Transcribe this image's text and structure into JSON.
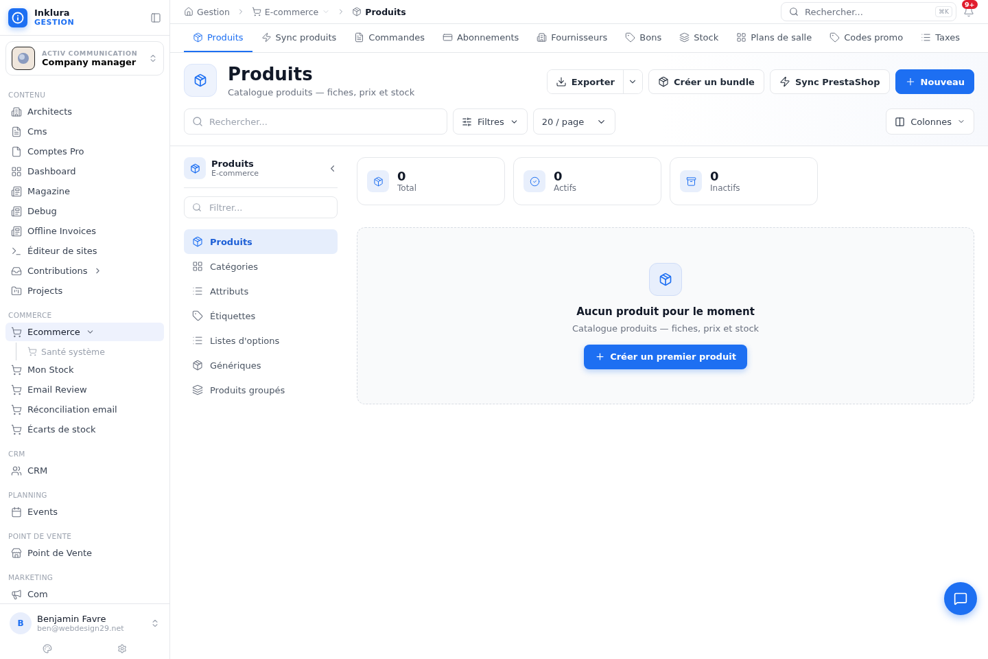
{
  "brand": {
    "name": "Inklura",
    "subtitle": "GESTION"
  },
  "workspace": {
    "org": "ACTIV COMMUNICATION",
    "role": "Company manager"
  },
  "sidebar": {
    "sections": [
      {
        "label": "CONTENU",
        "items": [
          {
            "label": "Architects",
            "selected": false
          },
          {
            "label": "Cms",
            "selected": false
          },
          {
            "label": "Comptes Pro",
            "selected": false
          },
          {
            "label": "Dashboard",
            "selected": false
          },
          {
            "label": "Magazine",
            "selected": false
          },
          {
            "label": "Debug",
            "selected": false
          },
          {
            "label": "Offline Invoices",
            "selected": false
          },
          {
            "label": "Éditeur de sites",
            "selected": false
          },
          {
            "label": "Contributions",
            "selected": false,
            "expanded": false
          },
          {
            "label": "Projects",
            "selected": false
          }
        ]
      },
      {
        "label": "COMMERCE",
        "items": [
          {
            "label": "Ecommerce",
            "selected": true,
            "expanded": true,
            "children": [
              {
                "label": "Santé système",
                "selected": false
              }
            ]
          },
          {
            "label": "Mon Stock",
            "selected": false
          },
          {
            "label": "Email Review",
            "selected": false
          },
          {
            "label": "Réconciliation email",
            "selected": false
          },
          {
            "label": "Écarts de stock",
            "selected": false
          }
        ]
      },
      {
        "label": "CRM",
        "items": [
          {
            "label": "CRM",
            "selected": false
          }
        ]
      },
      {
        "label": "PLANNING",
        "items": [
          {
            "label": "Events",
            "selected": false
          }
        ]
      },
      {
        "label": "POINT DE VENTE",
        "items": [
          {
            "label": "Point de Vente",
            "selected": false
          }
        ]
      },
      {
        "label": "MARKETING",
        "items": [
          {
            "label": "Com",
            "selected": false
          }
        ]
      }
    ]
  },
  "user": {
    "initial": "B",
    "name": "Benjamin Favre",
    "email": "ben@webdesign29.net"
  },
  "breadcrumb": [
    {
      "label": "Gestion",
      "current": false
    },
    {
      "label": "E-commerce",
      "current": false
    },
    {
      "label": "Produits",
      "current": true
    }
  ],
  "global_search": {
    "placeholder": "Rechercher...",
    "shortcut": "⌘K"
  },
  "notifications": {
    "badge": "9+"
  },
  "tabs": [
    {
      "label": "Produits",
      "selected": true
    },
    {
      "label": "Sync produits",
      "selected": false
    },
    {
      "label": "Commandes",
      "selected": false
    },
    {
      "label": "Abonnements",
      "selected": false
    },
    {
      "label": "Fournisseurs",
      "selected": false
    },
    {
      "label": "Bons",
      "selected": false
    },
    {
      "label": "Stock",
      "selected": false
    },
    {
      "label": "Plans de salle",
      "selected": false
    },
    {
      "label": "Codes promo",
      "selected": false
    },
    {
      "label": "Taxes",
      "selected": false
    }
  ],
  "page": {
    "title": "Produits",
    "subtitle": "Catalogue produits — fiches, prix et stock"
  },
  "actions": [
    {
      "kind": "split",
      "label": "Exporter"
    },
    {
      "kind": "outline",
      "label": "Créer un bundle"
    },
    {
      "kind": "outline",
      "label": "Sync PrestaShop"
    },
    {
      "kind": "primary",
      "label": "Nouveau"
    }
  ],
  "toolbar": {
    "search_placeholder": "Rechercher...",
    "filters": "Filtres",
    "page_size": "20 / page",
    "columns": "Colonnes"
  },
  "subnav": {
    "title": "Produits",
    "subtitle": "E-commerce",
    "filter_placeholder": "Filtrer...",
    "items": [
      {
        "label": "Produits",
        "selected": true
      },
      {
        "label": "Catégories",
        "selected": false
      },
      {
        "label": "Attributs",
        "selected": false
      },
      {
        "label": "Étiquettes",
        "selected": false
      },
      {
        "label": "Listes d'options",
        "selected": false
      },
      {
        "label": "Génériques",
        "selected": false
      },
      {
        "label": "Produits groupés",
        "selected": false
      }
    ]
  },
  "stats": [
    {
      "value": "0",
      "label": "Total"
    },
    {
      "value": "0",
      "label": "Actifs"
    },
    {
      "value": "0",
      "label": "Inactifs"
    }
  ],
  "empty_state": {
    "title": "Aucun produit pour le moment",
    "text": "Catalogue produits — fiches, prix et stock",
    "button": "Créer un premier produit"
  }
}
